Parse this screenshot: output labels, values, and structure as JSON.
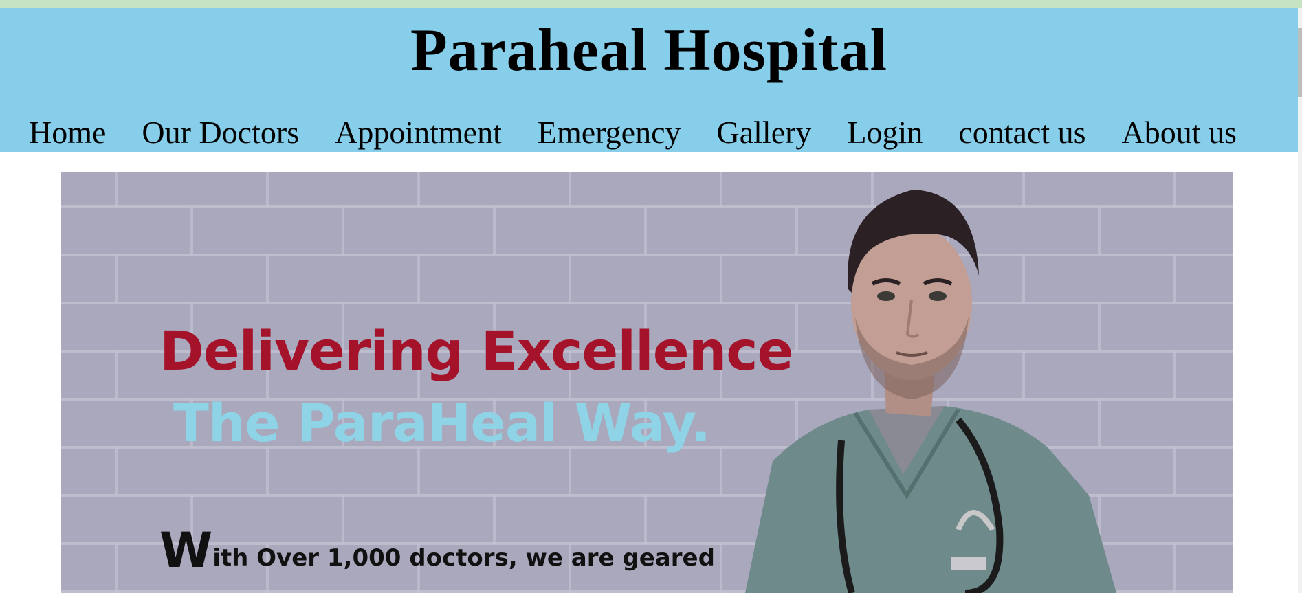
{
  "header": {
    "title": "Paraheal Hospital"
  },
  "nav": {
    "items": [
      {
        "label": "Home"
      },
      {
        "label": "Our Doctors"
      },
      {
        "label": "Appointment"
      },
      {
        "label": "Emergency"
      },
      {
        "label": "Gallery"
      },
      {
        "label": "Login"
      },
      {
        "label": "contact us"
      },
      {
        "label": "About us"
      }
    ]
  },
  "hero": {
    "heading_1": "Delivering Excellence",
    "heading_2": "The ParaHeal Way.",
    "body_drop_cap": "W",
    "body_text": "ith Over 1,000 doctors, we are geared"
  },
  "colors": {
    "header_bg": "#87ceeb",
    "top_strip": "#c6e3c4",
    "hero_heading_1": "#a4132a",
    "hero_heading_2": "#8fd3e6"
  }
}
